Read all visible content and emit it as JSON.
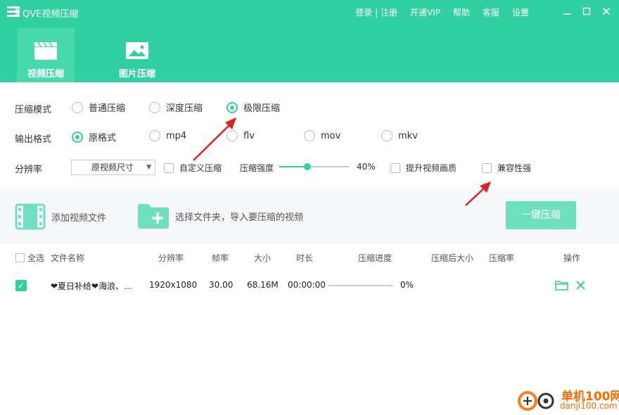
{
  "app": {
    "title": "QVE视频压缩"
  },
  "top_menu": {
    "login": "登录",
    "sep": " | ",
    "register": "注册",
    "vip": "开通VIP",
    "help": "帮助",
    "service": "客服",
    "settings": "设置"
  },
  "tabs": [
    {
      "label": "视频压缩",
      "active": true
    },
    {
      "label": "图片压缩",
      "active": false
    }
  ],
  "settings": {
    "mode_label": "压缩模式",
    "modes": [
      {
        "label": "普通压缩",
        "selected": false
      },
      {
        "label": "深度压缩",
        "selected": false
      },
      {
        "label": "极限压缩",
        "selected": true
      }
    ],
    "format_label": "输出格式",
    "formats": [
      {
        "label": "原格式",
        "selected": true
      },
      {
        "label": "mp4",
        "selected": false
      },
      {
        "label": "flv",
        "selected": false
      },
      {
        "label": "mov",
        "selected": false
      },
      {
        "label": "mkv",
        "selected": false
      }
    ],
    "resolution_label": "分辨率",
    "resolution_value": "原视频尺寸",
    "custom_compress": "自定义压缩",
    "strength_label": "压缩强度",
    "strength_value": "40%",
    "strength_fraction": 0.4,
    "enhance_quality": "提升视频画质",
    "compatibility": "兼容性强"
  },
  "toolbar": {
    "add_file": "添加视频文件",
    "add_folder": "选择文件夹，导入要压缩的视频",
    "compress_button": "一键压缩"
  },
  "table": {
    "headers": {
      "select_all": "全选",
      "name": "文件名称",
      "resolution": "分辨率",
      "fps": "帧率",
      "size": "大小",
      "duration": "时长",
      "progress": "压缩进度",
      "after_size": "压缩后大小",
      "ratio": "压缩率",
      "actions": "操作"
    },
    "rows": [
      {
        "checked": true,
        "name": "❤夏日补给❤海浪、…",
        "resolution": "1920x1080",
        "fps": "30.00",
        "size": "68.16M",
        "duration": "00:00:00",
        "progress": 0,
        "progress_text": "0%"
      }
    ]
  },
  "watermark": {
    "brand": "单机100网",
    "url": "danji100.com"
  },
  "colors": {
    "accent": "#31d0a0",
    "arrow": "#e02020"
  }
}
